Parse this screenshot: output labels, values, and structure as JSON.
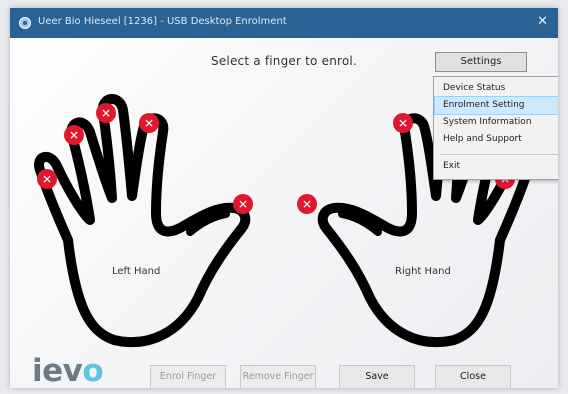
{
  "window": {
    "title": "Ueer Bio Hieseel [1236] - USB Desktop Enrolment",
    "close_glyph": "✕",
    "app_icon": "fingerprint-app-icon"
  },
  "instruction": "Select a finger to enrol.",
  "hands": {
    "left_label": "Left Hand",
    "right_label": "Right Hand",
    "outline_color": "#000000",
    "marker_color": "#e0182d",
    "marker_glyph": "✕"
  },
  "settings": {
    "button_label": "Settings",
    "menu": [
      {
        "label": "Device Status"
      },
      {
        "label": "Enrolment Setting"
      },
      {
        "label": "System Information"
      },
      {
        "label": "Help and Support"
      },
      {
        "label": "Exit"
      }
    ],
    "highlighted_item": "Enrolment Setting"
  },
  "logo": {
    "prefix": "iev",
    "suffix": "o"
  },
  "buttons": {
    "enrol": "Enrol Finger",
    "remove": "Remove Finger",
    "save": "Save",
    "close": "Close"
  },
  "colors": {
    "titlebar": "#2b6296",
    "highlight": "#cde8ff",
    "logo_grey": "#6b7b86",
    "logo_blue": "#5fc3e4"
  }
}
